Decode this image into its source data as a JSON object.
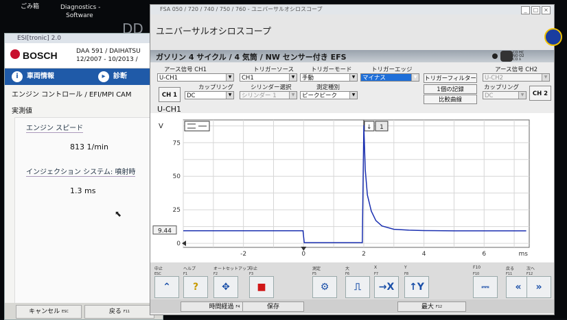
{
  "desktop": {
    "trash_label": "ごみ箱",
    "diag_label_1": "Diagnostics -",
    "diag_label_2": "Software",
    "dd_label": "DD"
  },
  "esi": {
    "title": "ESI[tronic] 2.0",
    "brand": "BOSCH",
    "vehicle_line1": "DAA 591 / DAIHATSU",
    "vehicle_line2": "12/2007 - 10/2013 /",
    "tabs": [
      {
        "label": "車両情報",
        "icon": "info-icon"
      },
      {
        "label": "診断",
        "icon": "car-icon"
      }
    ],
    "breadcrumb": "エンジン コントロール / EFI/MPI CAM",
    "section_title": "実測値",
    "measurements": [
      {
        "label": "エンジン スピード",
        "value": "813 1/min"
      },
      {
        "label": "インジェクション システム: 噴射時",
        "value": "1.3 ms"
      }
    ],
    "bottom_buttons": [
      "キャンセル",
      "戻る"
    ],
    "bottom_keys": [
      "ESC",
      "F11"
    ]
  },
  "scope": {
    "window_title": "FSA 050 / 720 / 740 / 750 / 760 - ユニバーサルオシロスコープ",
    "heading": "ユニバーサルオシロスコープ",
    "mode": "ガソリン 4 サイクル / 4 気筒 / NW センサー付き EFS",
    "mode_small": [
      "CO HC",
      "NO O2",
      "CO λ"
    ],
    "ch1": {
      "ground_label": "アース信号 CH1",
      "ground_value": "U-CH1",
      "coupling_label": "カップリング",
      "coupling_value": "DC",
      "button": "CH 1"
    },
    "trigger": {
      "source_label": "トリガーソース",
      "source_value": "CH1",
      "mode_label": "トリガーモード",
      "mode_value": "手動",
      "edge_label": "トリガーエッジ",
      "edge_value": "マイナス",
      "filter_button": "トリガーフィルター",
      "cylinder_label": "シリンダー選択",
      "cylinder_value": "シリンダー 1",
      "measure_label": "測定種別",
      "measure_value": "ピークピーク",
      "single_button": "1個の記録",
      "compare_button": "比較曲線"
    },
    "ch2": {
      "ground_label": "アース信号 CH2",
      "ground_value": "U-CH2",
      "coupling_label": "カップリング",
      "coupling_value": "DC",
      "button": "CH 2"
    },
    "plot_title": "U-CH1",
    "y_unit": "V",
    "x_unit": "ms",
    "cursor_badge": "1",
    "level_readout": "9.44",
    "footer": {
      "labels": [
        "中止",
        "ヘルプ",
        "オートセットアップ",
        "中止",
        "測定",
        "大",
        "X",
        "Y",
        "F10",
        "戻る",
        "次へ"
      ],
      "keys": [
        "ESC",
        "F1",
        "F2",
        "F3",
        "F5",
        "F6",
        "F7",
        "F8",
        "F10",
        "F11",
        "F12"
      ],
      "status_buttons": [
        "時間経過",
        "保存",
        "最大"
      ],
      "status_keys": [
        "F4",
        "F12"
      ]
    }
  },
  "chart_data": {
    "type": "line",
    "title": "U-CH1",
    "xlabel": "ms",
    "ylabel": "V",
    "xlim": [
      -4,
      7.5
    ],
    "ylim": [
      -3,
      92
    ],
    "x_ticks": [
      -2,
      0,
      2,
      4,
      6
    ],
    "y_ticks": [
      0,
      25,
      50,
      75
    ],
    "grid": true,
    "series": [
      {
        "color": "#1a2fb0",
        "x": [
          -4,
          -0.02,
          0.02,
          1.5,
          1.95,
          2.0,
          2.05,
          2.12,
          2.25,
          2.4,
          2.6,
          3.0,
          3.5,
          4.0,
          5.0,
          6.0,
          7.4
        ],
        "y": [
          9.4,
          9.4,
          0.5,
          0.5,
          0.5,
          88,
          55,
          36,
          24,
          17,
          13,
          10.5,
          9.8,
          9.5,
          9.3,
          9.3,
          9.3
        ]
      }
    ],
    "annotations": [
      {
        "text": "9.44",
        "y": 9.44
      }
    ]
  }
}
